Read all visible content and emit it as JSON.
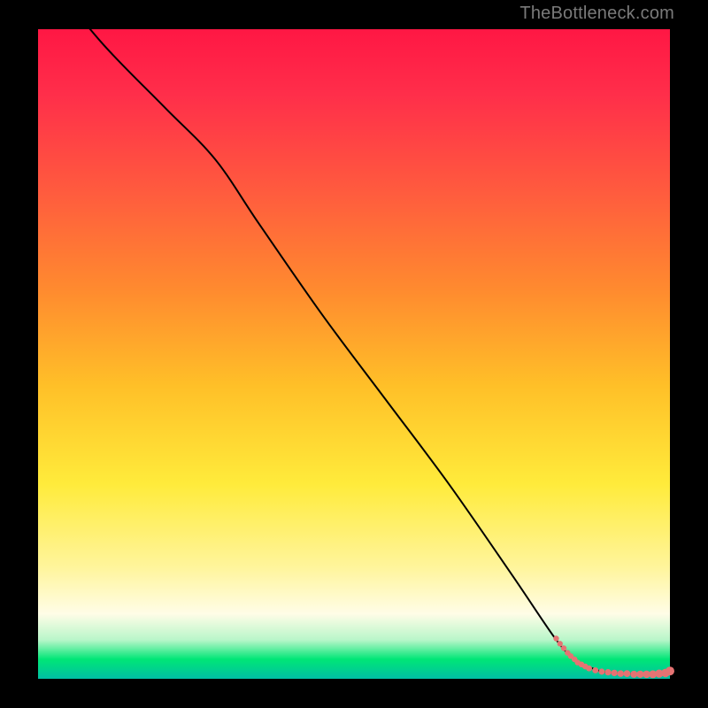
{
  "watermark": "TheBottleneck.com",
  "chart_data": {
    "type": "line",
    "title": "",
    "xlabel": "",
    "ylabel": "",
    "xlim": [
      0,
      100
    ],
    "ylim": [
      0,
      100
    ],
    "grid": false,
    "legend": false,
    "series": [
      {
        "name": "curve",
        "type": "line",
        "x": [
          0,
          10,
          20,
          28,
          35,
          45,
          55,
          65,
          75,
          82,
          85,
          88,
          90,
          93,
          96,
          99,
          100
        ],
        "values": [
          110,
          98,
          88,
          80,
          70,
          56,
          43,
          30,
          16,
          6,
          3,
          1.5,
          1.0,
          0.8,
          0.7,
          0.8,
          1.2
        ]
      },
      {
        "name": "points",
        "type": "scatter",
        "x": [
          82.0,
          82.6,
          83.2,
          83.8,
          84.3,
          84.9,
          85.4,
          86.0,
          86.6,
          87.2,
          88.2,
          89.2,
          90.2,
          91.2,
          92.2,
          93.2,
          94.3,
          95.3,
          96.3,
          97.3,
          98.3,
          99.3,
          100.0
        ],
        "values": [
          6.2,
          5.4,
          4.7,
          4.0,
          3.5,
          3.0,
          2.5,
          2.2,
          1.9,
          1.6,
          1.3,
          1.1,
          1.0,
          0.9,
          0.8,
          0.8,
          0.7,
          0.7,
          0.7,
          0.7,
          0.8,
          0.9,
          1.2
        ]
      }
    ],
    "gradient_stops": [
      {
        "pos": 0.0,
        "color": "#ff1744"
      },
      {
        "pos": 0.55,
        "color": "#ffeb3b"
      },
      {
        "pos": 0.94,
        "color": "#b9f6ca"
      },
      {
        "pos": 1.0,
        "color": "#00bfa5"
      }
    ]
  },
  "style": {
    "curve_stroke": "#000000",
    "curve_width": 2.0,
    "point_fill": "#e57373",
    "point_radius_min": 3.2,
    "point_radius_max": 5.0
  }
}
